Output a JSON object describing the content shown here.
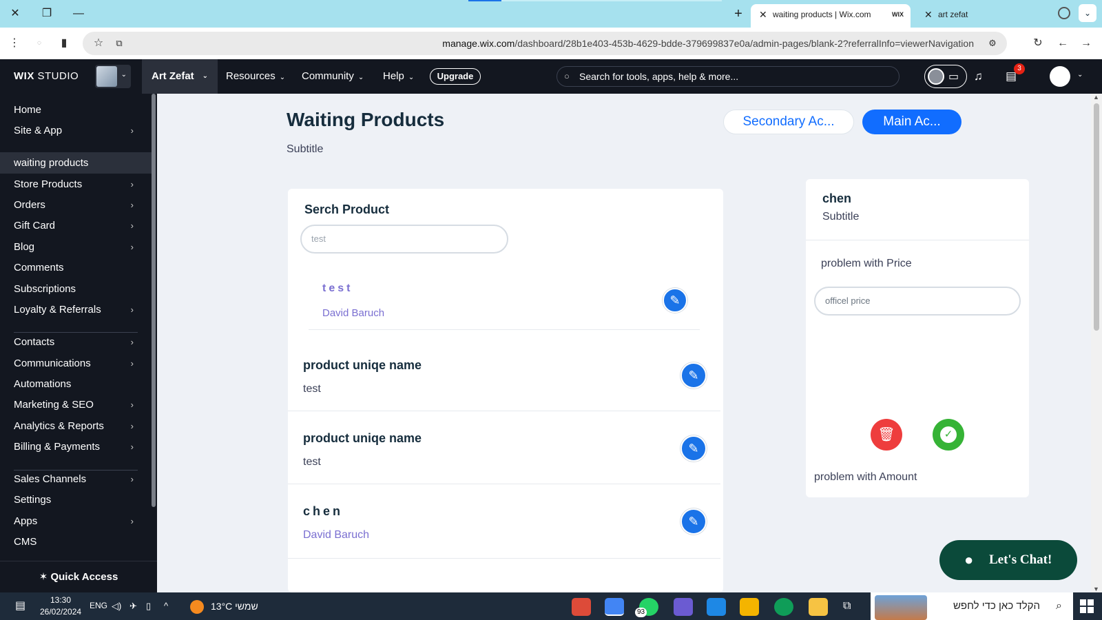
{
  "browser": {
    "tabs": [
      {
        "title": "waiting products | Wix.com",
        "favicon": "WIX",
        "active": true
      },
      {
        "title": "art zefat",
        "active": false
      }
    ],
    "url_host": "manage.wix.com",
    "url_path": "/dashboard/28b1e403-453b-4629-bdde-379699837e0a/admin-pages/blank-2?referralInfo=viewerNavigation"
  },
  "topbar": {
    "logo_bold": "WIX",
    "logo_rest": " STUDIO",
    "site_name": "Art Zefat",
    "nav": [
      "Resources",
      "Community",
      "Help"
    ],
    "upgrade": "Upgrade",
    "search_placeholder": "Search for tools, apps, help & more...",
    "notifications_badge": "3"
  },
  "sidebar": {
    "items": [
      {
        "label": "Home",
        "chevron": false
      },
      {
        "label": "Site & App",
        "chevron": true
      },
      {
        "label": "waiting products",
        "chevron": false,
        "active": true
      },
      {
        "label": "Store Products",
        "chevron": true
      },
      {
        "label": "Orders",
        "chevron": true
      },
      {
        "label": "Gift Card",
        "chevron": true
      },
      {
        "label": "Blog",
        "chevron": true
      },
      {
        "label": "Comments",
        "chevron": false
      },
      {
        "label": "Subscriptions",
        "chevron": false
      },
      {
        "label": "Loyalty & Referrals",
        "chevron": true
      },
      {
        "label": "Contacts",
        "chevron": true
      },
      {
        "label": "Communications",
        "chevron": true
      },
      {
        "label": "Automations",
        "chevron": false
      },
      {
        "label": "Marketing & SEO",
        "chevron": true
      },
      {
        "label": "Analytics & Reports",
        "chevron": true
      },
      {
        "label": "Billing & Payments",
        "chevron": true
      },
      {
        "label": "Sales Channels",
        "chevron": true
      },
      {
        "label": "Settings",
        "chevron": false
      },
      {
        "label": "Apps",
        "chevron": true
      },
      {
        "label": "CMS",
        "chevron": false
      }
    ],
    "quick_access": "Quick Access"
  },
  "page": {
    "title": "Waiting Products",
    "subtitle": "Subtitle",
    "secondary_action": "Secondary Ac...",
    "main_action": "Main Ac..."
  },
  "search_card": {
    "title": "Serch Product",
    "search_value": "test",
    "products": [
      {
        "name": "test",
        "meta": "David Baruch"
      },
      {
        "name": "product uniqe name",
        "meta": "test"
      },
      {
        "name": "product uniqe name",
        "meta": "test"
      },
      {
        "name": "chen",
        "meta": "David Baruch"
      }
    ]
  },
  "detail_card": {
    "title": "chen",
    "subtitle": "Subtitle",
    "price_label": "problem with Price",
    "price_placeholder": "officel price",
    "amount_label": "problem with Amount"
  },
  "chat": {
    "label": "Let's Chat!"
  },
  "taskbar": {
    "time": "13:30",
    "date": "26/02/2024",
    "language": "ENG",
    "weather_temp": "13°C",
    "weather_day": "שמשי",
    "whatsapp_badge": "93",
    "search_placeholder": "הקלד כאן כדי לחפש"
  },
  "colors": {
    "accent": "#116dff",
    "sidebar_bg": "#131720",
    "delete": "#ee3d3d",
    "approve": "#36b336",
    "chat_bg": "#0b4a3a"
  }
}
